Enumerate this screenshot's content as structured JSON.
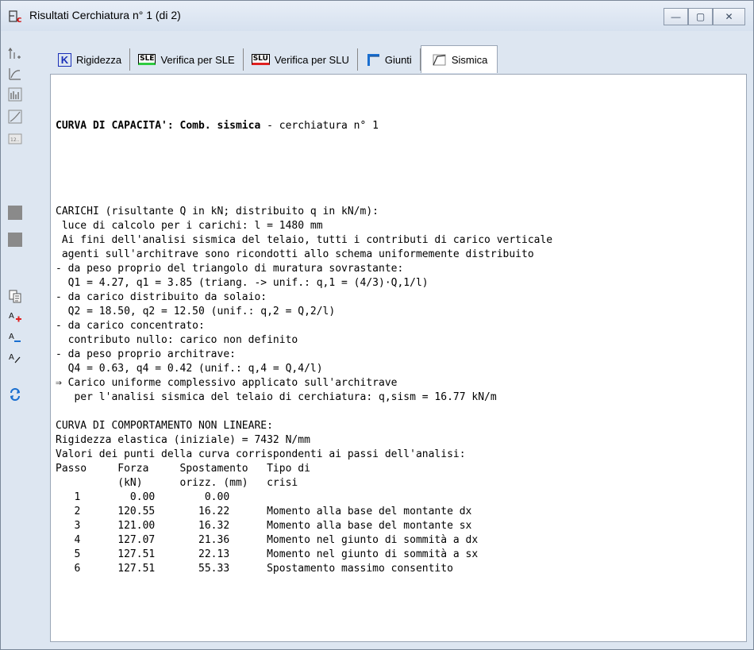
{
  "window": {
    "title": "Risultati Cerchiatura n° 1 (di 2)",
    "app_icon_glyph": "E",
    "app_icon_sub": "c"
  },
  "window_buttons": {
    "minimize": "—",
    "maximize": "▢",
    "close": "✕"
  },
  "tabs": [
    {
      "label": "Rigidezza",
      "icon": "K"
    },
    {
      "label": "Verifica per SLE",
      "icon": "SLE"
    },
    {
      "label": "Verifica per SLU",
      "icon": "SLU"
    },
    {
      "label": "Giunti",
      "icon": "giunti-icon"
    },
    {
      "label": "Sismica",
      "icon": "sismica-icon"
    }
  ],
  "toolbar_icons": [
    "step-icon",
    "curve-icon",
    "chart-icon",
    "graph-icon",
    "page-icon",
    "gray-square-icon",
    "gray-square-icon",
    "copy-icon",
    "font-increase-icon",
    "font-decrease-icon",
    "font-italic-icon",
    "refresh-icon"
  ],
  "report": {
    "heading_bold": "CURVA DI CAPACITA': Comb. sismica",
    "heading_rest": " - cerchiatura n° 1",
    "lines": [
      "CARICHI (risultante Q in kN; distribuito q in kN/m):",
      " luce di calcolo per i carichi: l = 1480 mm",
      " Ai fini dell'analisi sismica del telaio, tutti i contributi di carico verticale",
      " agenti sull'architrave sono ricondotti allo schema uniformemente distribuito",
      "- da peso proprio del triangolo di muratura sovrastante:",
      "  Q1 = 4.27, q1 = 3.85 (triang. -> unif.: q,1 = (4/3)·Q,1/l)",
      "- da carico distribuito da solaio:",
      "  Q2 = 18.50, q2 = 12.50 (unif.: q,2 = Q,2/l)",
      "- da carico concentrato:",
      "  contributo nullo: carico non definito",
      "- da peso proprio architrave:",
      "  Q4 = 0.63, q4 = 0.42 (unif.: q,4 = Q,4/l)",
      "⇒ Carico uniforme complessivo applicato sull'architrave",
      "   per l'analisi sismica del telaio di cerchiatura: q,sism = 16.77 kN/m",
      "",
      "CURVA DI COMPORTAMENTO NON LINEARE:",
      "Rigidezza elastica (iniziale) = 7432 N/mm",
      "Valori dei punti della curva corrispondenti ai passi dell'analisi:",
      "Passo     Forza     Spostamento   Tipo di",
      "          (kN)      orizz. (mm)   crisi",
      "   1        0.00        0.00",
      "   2      120.55       16.22      Momento alla base del montante dx",
      "   3      121.00       16.32      Momento alla base del montante sx",
      "   4      127.07       21.36      Momento nel giunto di sommità a dx",
      "   5      127.51       22.13      Momento nel giunto di sommità a sx",
      "   6      127.51       55.33      Spostamento massimo consentito"
    ]
  }
}
